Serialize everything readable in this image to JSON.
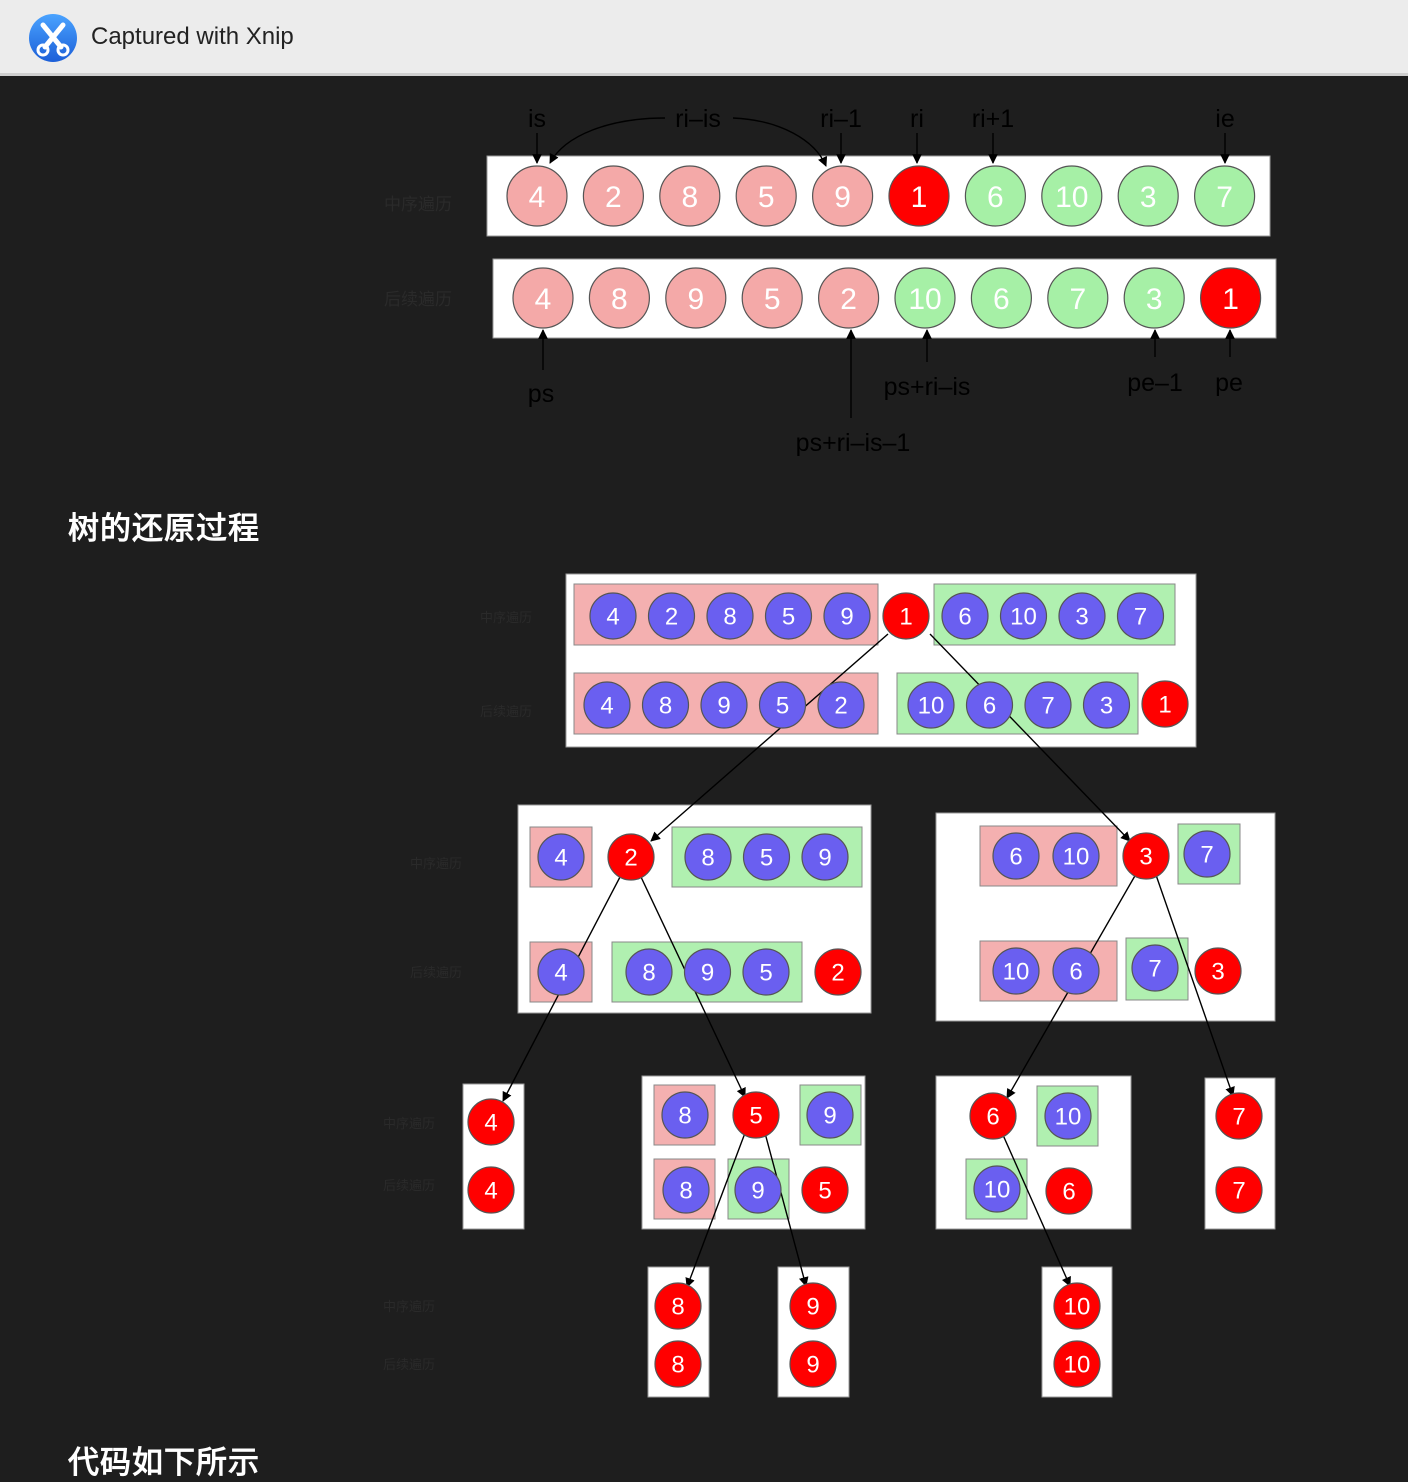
{
  "window": {
    "title": "Captured with Xnip",
    "icon": "xnip-scissors-icon"
  },
  "colors": {
    "left_node": "#f4a9a8",
    "right_node": "#a6f0a6",
    "root_node": "#ff0000",
    "blue_node": "#6a5ff0",
    "left_box": "#f4b0b0",
    "right_box": "#b0f0b0",
    "panel": "#ffffff",
    "background": "#1e1e1e"
  },
  "row_labels": {
    "inorder": "中序遍历",
    "postorder": "后续遍历"
  },
  "fig1": {
    "inorder": [
      {
        "v": "4",
        "c": "left"
      },
      {
        "v": "2",
        "c": "left"
      },
      {
        "v": "8",
        "c": "left"
      },
      {
        "v": "5",
        "c": "left"
      },
      {
        "v": "9",
        "c": "left"
      },
      {
        "v": "1",
        "c": "root"
      },
      {
        "v": "6",
        "c": "right"
      },
      {
        "v": "10",
        "c": "right"
      },
      {
        "v": "3",
        "c": "right"
      },
      {
        "v": "7",
        "c": "right"
      }
    ],
    "postorder": [
      {
        "v": "4",
        "c": "left"
      },
      {
        "v": "8",
        "c": "left"
      },
      {
        "v": "9",
        "c": "left"
      },
      {
        "v": "5",
        "c": "left"
      },
      {
        "v": "2",
        "c": "left"
      },
      {
        "v": "10",
        "c": "right"
      },
      {
        "v": "6",
        "c": "right"
      },
      {
        "v": "7",
        "c": "right"
      },
      {
        "v": "3",
        "c": "right"
      },
      {
        "v": "1",
        "c": "root"
      }
    ],
    "top_labels": {
      "is": "is",
      "ri_is": "ri–is",
      "ri_1": "ri–1",
      "ri": "ri",
      "ri_p1": "ri+1",
      "ie": "ie"
    },
    "bottom_labels": {
      "ps": "ps",
      "ps_ri_is": "ps+ri–is",
      "ps_ri_is_1": "ps+ri–is–1",
      "pe_1": "pe–1",
      "pe": "pe"
    }
  },
  "headings": {
    "tree_restore": "树的还原过程",
    "code_below": "代码如下所示"
  },
  "tree": {
    "n1": {
      "inorder_left": [
        "4",
        "2",
        "8",
        "5",
        "9"
      ],
      "root": "1",
      "inorder_right": [
        "6",
        "10",
        "3",
        "7"
      ],
      "postorder_left": [
        "4",
        "8",
        "9",
        "5",
        "2"
      ],
      "postorder_right": [
        "10",
        "6",
        "7",
        "3"
      ]
    },
    "n2": {
      "inorder_left": [
        "4"
      ],
      "root": "2",
      "inorder_right": [
        "8",
        "5",
        "9"
      ],
      "postorder_left": [
        "4"
      ],
      "postorder_right": [
        "8",
        "9",
        "5"
      ]
    },
    "n3": {
      "inorder_left": [
        "6",
        "10"
      ],
      "root": "3",
      "inorder_right": [
        "7"
      ],
      "postorder_left": [
        "10",
        "6"
      ],
      "postorder_right": [
        "7"
      ]
    },
    "n4": {
      "root": "4"
    },
    "n5": {
      "inorder_left": [
        "8"
      ],
      "root": "5",
      "inorder_right": [
        "9"
      ],
      "postorder_left": [
        "8"
      ],
      "postorder_right": [
        "9"
      ]
    },
    "n6": {
      "root": "6",
      "inorder_right": [
        "10"
      ],
      "postorder_right": [
        "10"
      ]
    },
    "n7": {
      "root": "7"
    },
    "n8": {
      "root": "8"
    },
    "n9": {
      "root": "9"
    },
    "n10": {
      "root": "10"
    }
  }
}
